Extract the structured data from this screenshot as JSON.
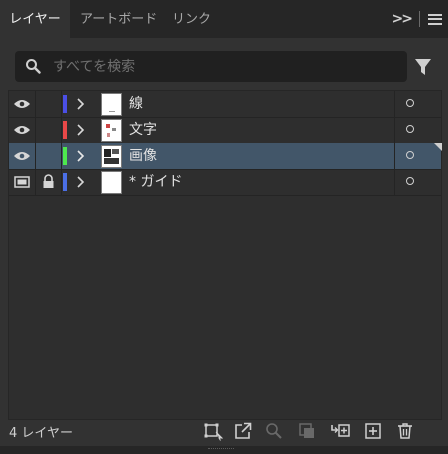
{
  "tabs": [
    {
      "label": "レイヤー",
      "active": true
    },
    {
      "label": "アートボード",
      "active": false
    },
    {
      "label": "リンク",
      "active": false
    }
  ],
  "tabbar_icons": [
    "panel-overflow-icon",
    "panel-menu-icon"
  ],
  "search": {
    "placeholder": "すべてを検索",
    "value": ""
  },
  "layers": [
    {
      "name": "線",
      "color": "#4b4fe6",
      "visible": true,
      "locked": false,
      "selected": false
    },
    {
      "name": "文字",
      "color": "#e84848",
      "visible": true,
      "locked": false,
      "selected": false
    },
    {
      "name": "画像",
      "color": "#4ee84e",
      "visible": true,
      "locked": false,
      "selected": true
    },
    {
      "name": "* ガイド",
      "color": "#4b6fe6",
      "visible": true,
      "locked": true,
      "selected": false
    }
  ],
  "footer": {
    "count_label": "4 レイヤー",
    "tools": [
      "collect-for-export-icon",
      "export-selection-icon",
      "locate-object-icon",
      "make-clipping-mask-icon",
      "create-sublayer-icon",
      "create-new-layer-icon",
      "delete-layer-icon"
    ]
  },
  "colors": {
    "selected_row": "#425669",
    "panel_bg": "#323232",
    "tabbar_bg": "#262626"
  }
}
